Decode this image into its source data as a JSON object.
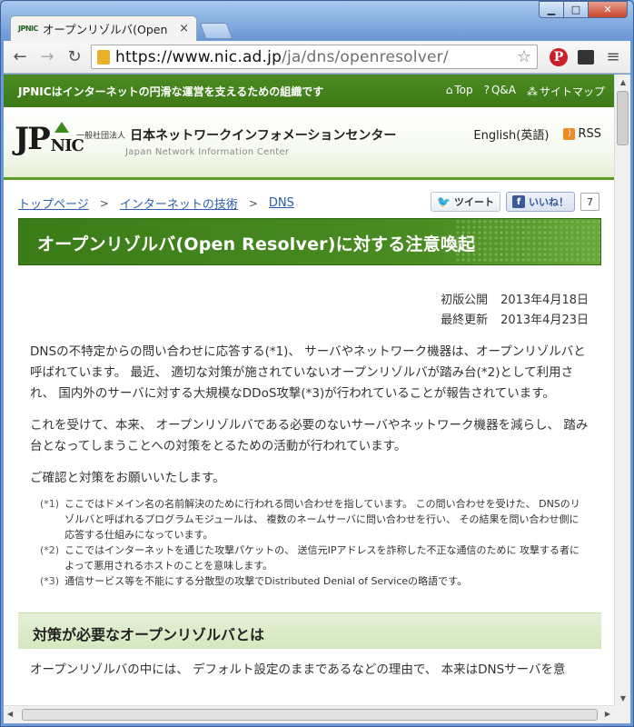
{
  "browser": {
    "tab_title": "オープンリゾルバ(Open",
    "tab_favicon": "JPNIC",
    "tab_close": "×",
    "url_host": "https://www.nic.ad.jp",
    "url_path": "/ja/dns/openresolver/",
    "back_icon": "←",
    "forward_icon": "→",
    "reload_icon": "↻",
    "star_icon": "☆",
    "pinterest_letter": "P",
    "menu_icon": "≡",
    "win_min": "▁",
    "win_max": "□",
    "win_close": "✕"
  },
  "topbar": {
    "tagline": "JPNICはインターネットの円滑な運営を支えるための組織です",
    "links": [
      {
        "icon": "⌂",
        "label": "Top"
      },
      {
        "icon": "?",
        "label": "Q&A"
      },
      {
        "icon": "⁂",
        "label": "サイトマップ"
      }
    ]
  },
  "header": {
    "logo_jp": "JP",
    "logo_nic": "NIC",
    "org_small": "一般社団法人",
    "org_name": "日本ネットワークインフォメーションセンター",
    "org_en": "Japan Network Information Center",
    "english": "English(英語)",
    "rss": "RSS"
  },
  "breadcrumb": [
    {
      "label": "トップページ"
    },
    {
      "label": "インターネットの技術"
    },
    {
      "label": "DNS"
    }
  ],
  "breadcrumb_sep": ">",
  "social": {
    "tweet": "ツイート",
    "like": "いいね！",
    "like_count": "7"
  },
  "page": {
    "title": "オープンリゾルバ(Open Resolver)に対する注意喚起",
    "published_label": "初版公開",
    "published_date": "2013年4月18日",
    "updated_label": "最終更新",
    "updated_date": "2013年4月23日",
    "paragraphs": [
      "DNSの不特定からの問い合わせに応答する(*1)、 サーバやネットワーク機器は、オープンリゾルバと呼ばれています。 最近、 適切な対策が施されていないオープンリゾルバが踏み台(*2)として利用され、 国内外のサーバに対する大規模なDDoS攻撃(*3)が行われていることが報告されています。",
      "これを受けて、本来、 オープンリゾルバである必要のないサーバやネットワーク機器を減らし、 踏み台となってしまうことへの対策をとるための活動が行われています。",
      "ご確認と対策をお願いいたします。"
    ],
    "notes": [
      {
        "num": "(*1)",
        "text": "ここではドメイン名の名前解決のために行われる問い合わせを指しています。 この問い合わせを受けた、 DNSのリゾルバと呼ばれるプログラムモジュールは、 複数のネームサーバに問い合わせを行い、 その結果を問い合わせ側に応答する仕組みになっています。"
      },
      {
        "num": "(*2)",
        "text": "ここではインターネットを通じた攻撃パケットの、 送信元IPアドレスを詐称した不正な通信のために 攻撃する者によって悪用されるホストのことを意味します。"
      },
      {
        "num": "(*3)",
        "text": "通信サービス等を不能にする分散型の攻撃でDistributed Denial of Serviceの略語です。"
      }
    ],
    "section_heading": "対策が必要なオープンリゾルバとは",
    "cut_text": "オープンリゾルバの中には、 デフォルト設定のままであるなどの理由で、 本来はDNSサーバを意"
  }
}
